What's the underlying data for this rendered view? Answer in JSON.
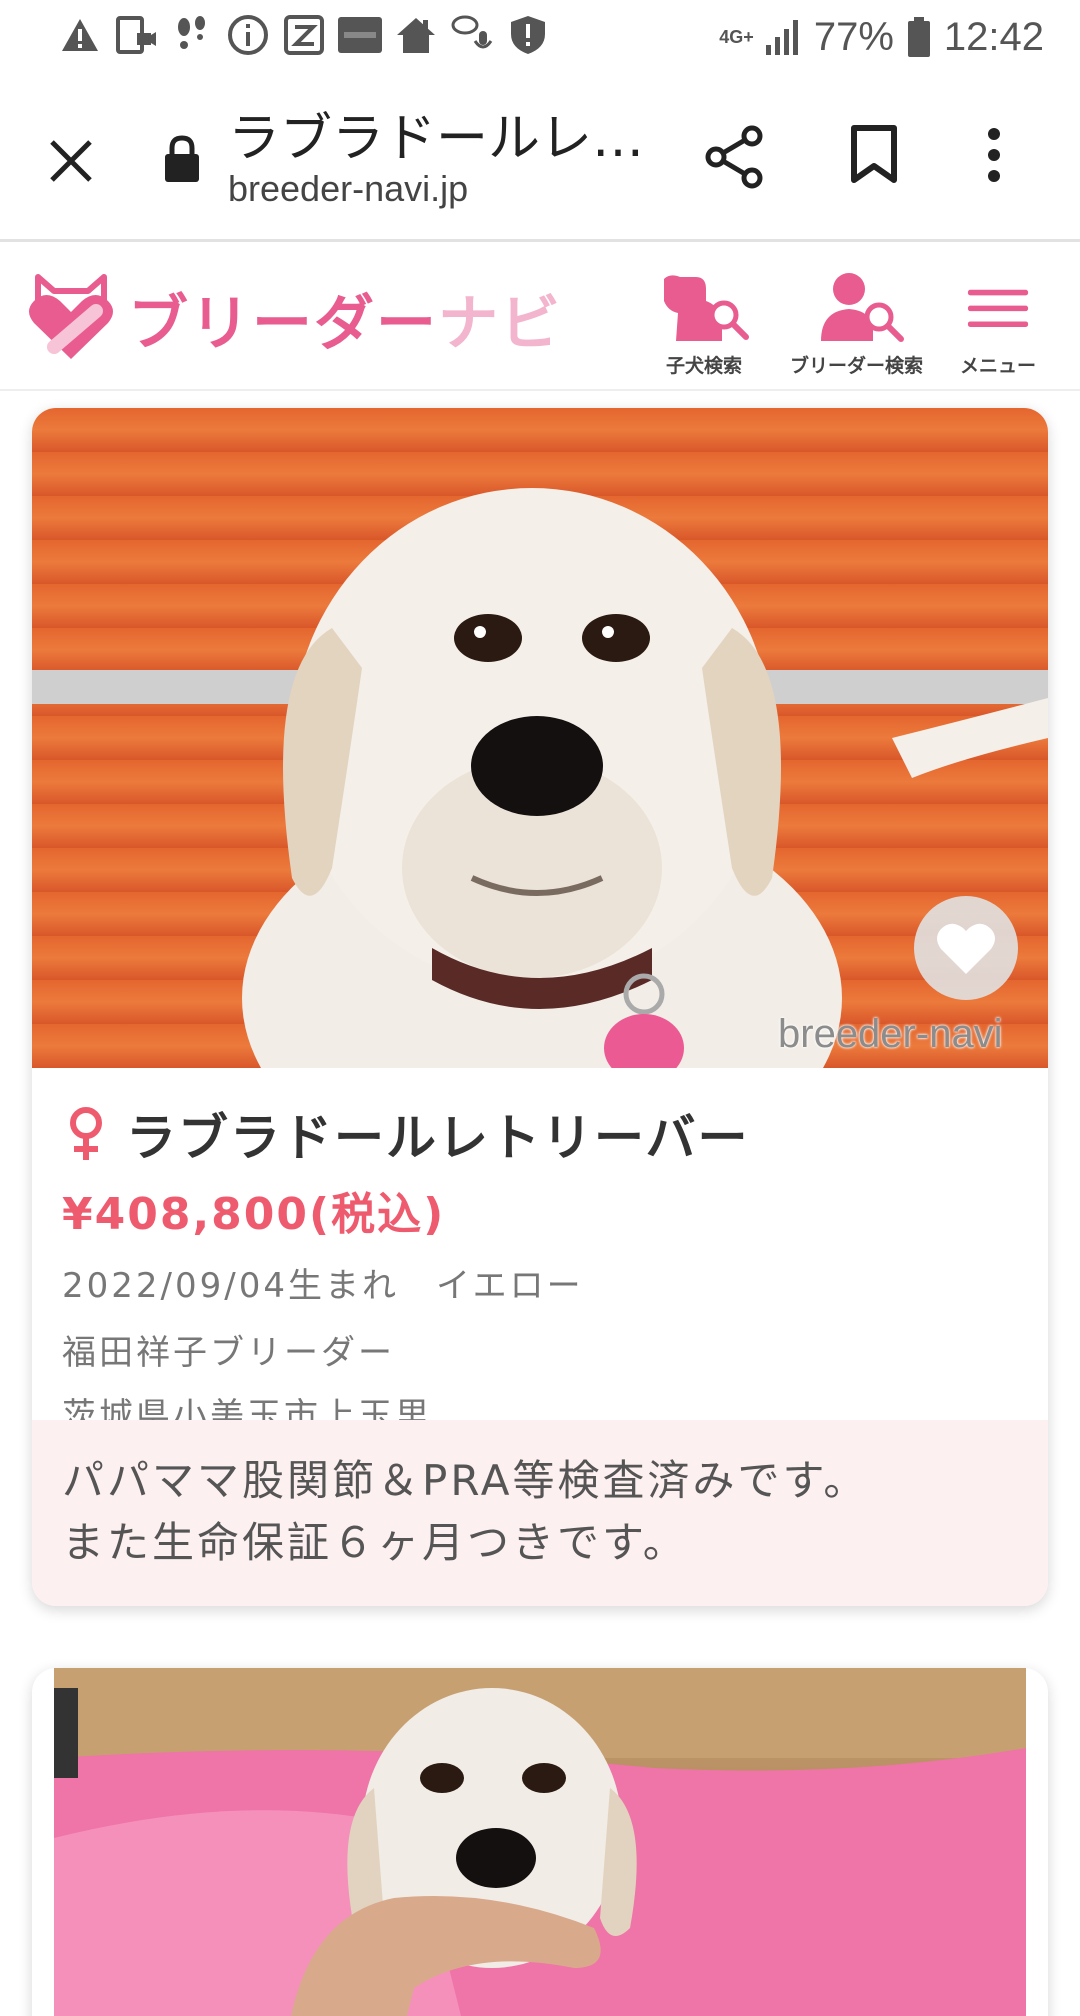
{
  "status_bar": {
    "network": "4G+",
    "battery": "77%",
    "time": "12:42",
    "left_icons": [
      "alert-icon",
      "tablet-video-icon",
      "footprints-icon",
      "info-icon",
      "z-app-icon",
      "yahoo-app-icon",
      "home-icon",
      "voice-chat-icon",
      "shield-icon"
    ]
  },
  "browser": {
    "page_title": "ラブラドールレ…",
    "url": "breeder-navi.jp"
  },
  "site": {
    "logo_text_main": "ブリーダー",
    "logo_text_sub": "ナビ",
    "brand_color": "#e85c8f",
    "nav": [
      {
        "label": "子犬検索",
        "icon": "puppy-search-icon"
      },
      {
        "label": "ブリーダー検索",
        "icon": "breeder-search-icon"
      },
      {
        "label": "メニュー",
        "icon": "menu-icon"
      }
    ]
  },
  "listing": {
    "gender": "female",
    "breed": "ラブラドールレトリーバー",
    "price": "¥408,800(税込)",
    "birth_color": "2022/09/04生まれ　イエロー",
    "breeder": "福田祥子ブリーダー",
    "location": "茨城県小美玉市上玉里",
    "note_line1": "パパママ股関節＆PRA等検査済みです。",
    "note_line2": "また生命保証６ヶ月つきです。",
    "watermark": "breeder-navi",
    "price_color": "#ef5b6e"
  }
}
